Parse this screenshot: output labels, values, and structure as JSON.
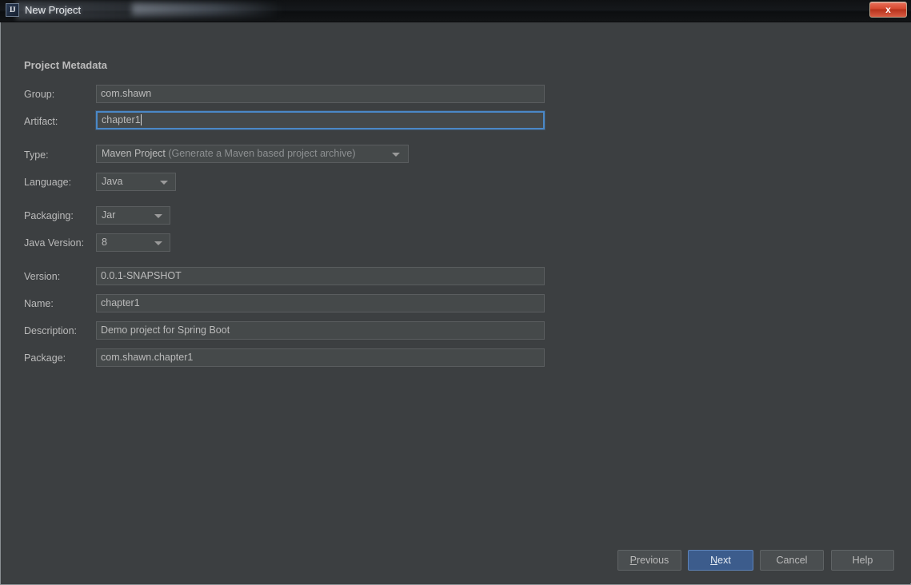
{
  "window": {
    "app_icon": "intellij-idea-icon",
    "title": "New Project",
    "close_label": "x"
  },
  "section": {
    "title": "Project Metadata"
  },
  "form": {
    "rows": [
      {
        "label": "Group:",
        "value": "com.shawn",
        "kind": "text",
        "focused": false
      },
      {
        "label": "Artifact:",
        "value": "chapter1",
        "kind": "text",
        "focused": true
      },
      {
        "label": "Type:",
        "value": "Maven Project",
        "value_suffix": " (Generate a Maven based project archive)",
        "kind": "combo",
        "focused": false
      },
      {
        "label": "Language:",
        "value": "Java",
        "kind": "combo",
        "focused": false
      },
      {
        "label": "Packaging:",
        "value": "Jar",
        "kind": "combo",
        "focused": false
      },
      {
        "label": "Java Version:",
        "value": "8",
        "kind": "combo",
        "focused": false
      },
      {
        "label": "Version:",
        "value": "0.0.1-SNAPSHOT",
        "kind": "text",
        "focused": false
      },
      {
        "label": "Name:",
        "value": "chapter1",
        "kind": "text",
        "focused": false
      },
      {
        "label": "Description:",
        "value": "Demo project for Spring Boot",
        "kind": "text",
        "focused": false
      },
      {
        "label": "Package:",
        "value": "com.shawn.chapter1",
        "kind": "text",
        "focused": false
      }
    ]
  },
  "buttons": {
    "previous": {
      "pre": "",
      "mnemonic": "P",
      "post": "revious"
    },
    "next": {
      "pre": "",
      "mnemonic": "N",
      "post": "ext"
    },
    "cancel": "Cancel",
    "help": "Help"
  },
  "colors": {
    "dialog_bg": "#3c3f41",
    "field_bg": "#45494a",
    "field_border": "#5a5d5f",
    "text": "#bbbbbb",
    "focus_border": "#4a88c7",
    "default_button_bg": "#3c5c8c",
    "close_button_bg": "#d5482f"
  }
}
